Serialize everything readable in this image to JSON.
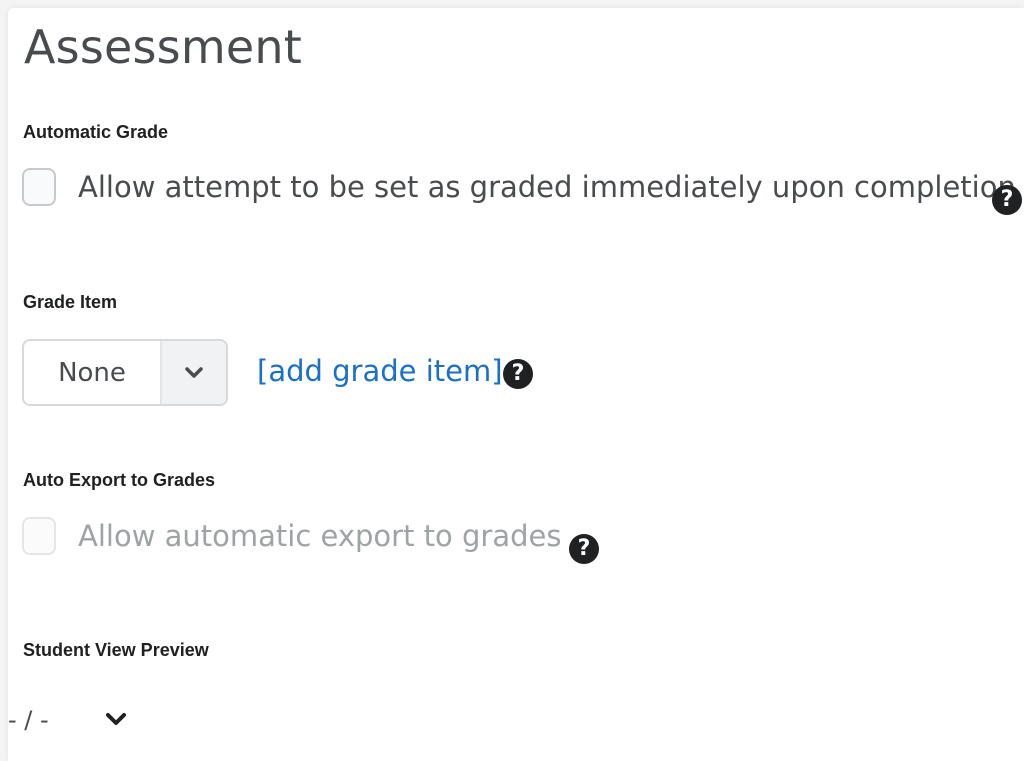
{
  "title": "Assessment",
  "automatic_grade": {
    "label": "Automatic Grade",
    "checkbox_label": "Allow attempt to be set as graded immediately upon completion",
    "checked": false,
    "help_icon": "question-circle-icon"
  },
  "grade_item": {
    "label": "Grade Item",
    "selected": "None",
    "link": "[add grade item]",
    "help_icon": "question-circle-icon"
  },
  "auto_export": {
    "label": "Auto Export to Grades",
    "checkbox_label": "Allow automatic export to grades",
    "checked": false,
    "disabled": true,
    "help_icon": "question-circle-icon"
  },
  "student_view_preview": {
    "label": "Student View Preview",
    "value": "- / -",
    "icon": "chevron-down-icon"
  },
  "colors": {
    "link": "#1a6fc9",
    "text": "#494c4e",
    "label": "#202122",
    "disabled_text": "#9ea3a6"
  }
}
